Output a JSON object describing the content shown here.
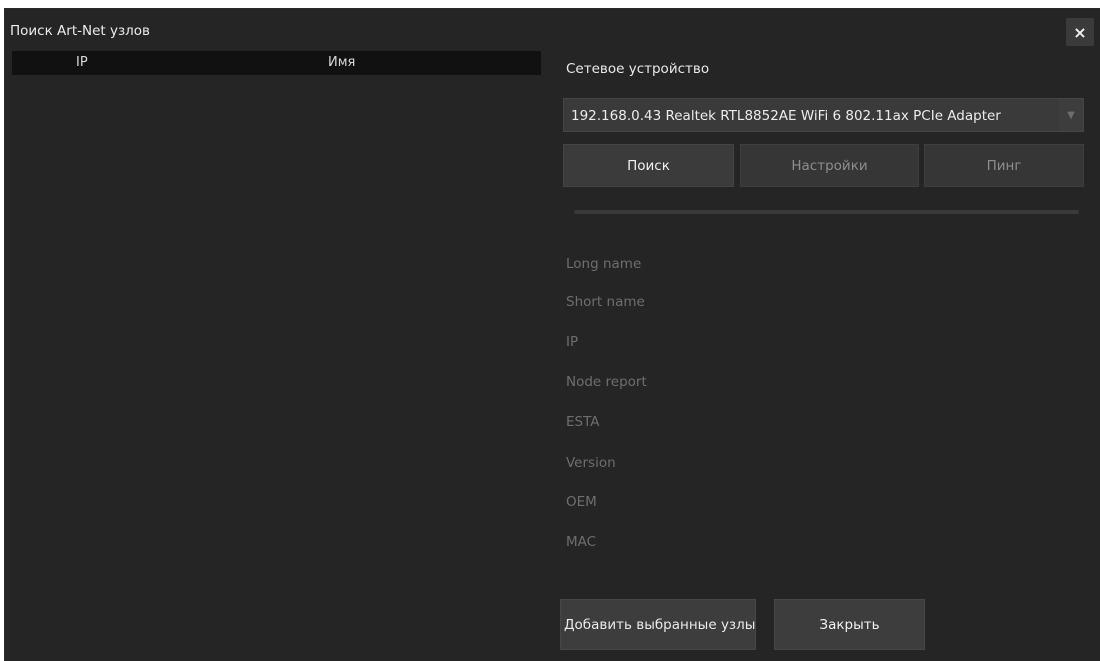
{
  "window": {
    "title": "Поиск Art-Net узлов",
    "close_icon": "×"
  },
  "table": {
    "columns": [
      "IP",
      "Имя"
    ],
    "rows": []
  },
  "device": {
    "label": "Сетевое устройство",
    "selected": "192.168.0.43 Realtek RTL8852AE WiFi 6 802.11ax PCIe Adapter",
    "arrow_icon": "▼"
  },
  "actions": {
    "search": "Поиск",
    "settings": "Настройки",
    "ping": "Пинг"
  },
  "info_labels": [
    "Long name",
    "Short name",
    "IP",
    "Node report",
    "ESTA",
    "Version",
    "OEM",
    "MAC"
  ],
  "footer": {
    "add_selected": "Добавить выбранные узлы",
    "close": "Закрыть"
  },
  "colors": {
    "background": "#252525",
    "header_bg": "#111111",
    "button_bg": "#3b3b3b",
    "label_dim": "#6e6e6e",
    "text": "#ececec"
  }
}
